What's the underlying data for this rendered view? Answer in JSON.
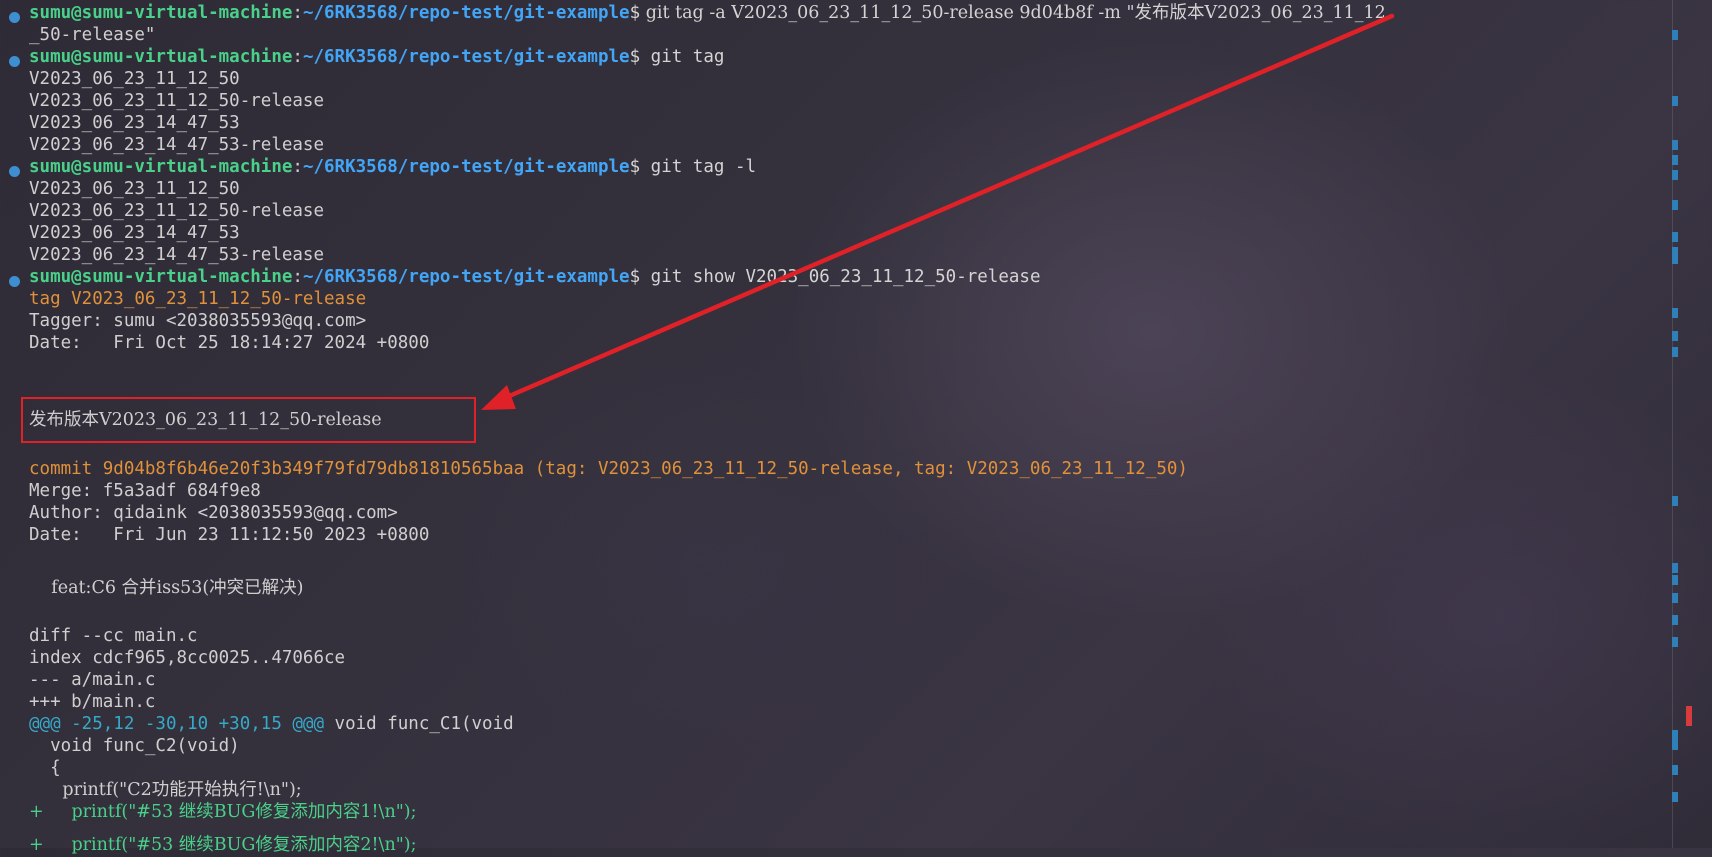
{
  "prompt": {
    "user": "sumu@sumu-virtual-machine",
    "path": "~/6RK3568/repo-test/git-example",
    "dollar": "$"
  },
  "commands": {
    "tag_create": " git tag -a V2023_06_23_11_12_50-release 9d04b8f -m \"发布版本V2023_06_23_11_12",
    "tag_create_wrap": "_50-release\"",
    "tag_list": " git tag",
    "tag_list_l": " git tag -l",
    "show": " git show V2023_06_23_11_12_50-release"
  },
  "tags": [
    "V2023_06_23_11_12_50",
    "V2023_06_23_11_12_50-release",
    "V2023_06_23_14_47_53",
    "V2023_06_23_14_47_53-release"
  ],
  "show_output": {
    "tag_line": "tag V2023_06_23_11_12_50-release",
    "tagger": "Tagger: sumu <2038035593@qq.com>",
    "tag_date": "Date:   Fri Oct 25 18:14:27 2024 +0800",
    "tag_message": "发布版本V2023_06_23_11_12_50-release",
    "commit_line": "commit 9d04b8f6b46e20f3b349f79fd79db81810565baa (tag: V2023_06_23_11_12_50-release, tag: V2023_06_23_11_12_50)",
    "merge": "Merge: f5a3adf 684f9e8",
    "author": "Author: qidaink <2038035593@qq.com>",
    "commit_date": "Date:   Fri Jun 23 11:12:50 2023 +0800",
    "commit_message": "    feat:C6 合并iss53(冲突已解决)",
    "diff_header": "diff --cc main.c",
    "index_line": "index cdcf965,8cc0025..47066ce",
    "minus_file": "--- a/main.c",
    "plus_file": "+++ b/main.c",
    "hunk_marker": "@@@ -25,12 -30,10 +30,15 @@@",
    "hunk_context": " void func_C1(void",
    "ctx1": "  void func_C2(void)",
    "ctx2": "  {",
    "ctx3": "      printf(\"C2功能开始执行!\\n\");",
    "added1": "+     printf(\"#53 继续BUG修复添加内容1!\\n\");",
    "added2_partial": "+     printf(\"#53 继续BUG修复添加内容2!\\n\");"
  },
  "colors": {
    "prompt_user": "#49d18a",
    "prompt_path": "#42a5f5",
    "tag_commit": "#e0913a",
    "hunk": "#36a9c9",
    "annotation_red": "#e02127"
  }
}
